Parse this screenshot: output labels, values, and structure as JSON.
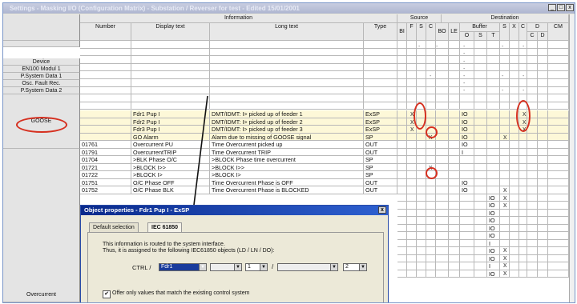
{
  "window": {
    "title": "Settings - Masking I/O (Configuration Matrix) - Substation / Reverser for test - Edited 15/01/2001",
    "min_label": "_",
    "max_label": "□",
    "close_label": "x"
  },
  "groups": {
    "information": "Information",
    "source": "Source",
    "destination": "Destination"
  },
  "columns": {
    "number": "Number",
    "display": "Display text",
    "long": "Long text",
    "type": "Type",
    "bi": "BI",
    "f": "F",
    "s": "S",
    "c": "C",
    "bo": "BO",
    "le": "LE",
    "buffer": "Buffer",
    "o": "O",
    "s2": "S",
    "t": "T",
    "s3": "S",
    "x": "X",
    "c2": "C",
    "d": "D",
    "dc": "C",
    "dd": "D",
    "cm": "CM"
  },
  "sections": {
    "device": "Device",
    "en100": "EN100 Modul 1",
    "psys1": "P.System Data 1",
    "oscfault": "Osc. Fault Rec.",
    "psys2": "P.System Data 2",
    "goose": "GOOSE",
    "overcurrent": "Overcurrent"
  },
  "rows": [
    {
      "number": "",
      "display": "Fdr1 Pup I",
      "long": "DMT/IDMT: I> picked up of feeder 1",
      "type": "ExSP",
      "buf": "IO"
    },
    {
      "number": "",
      "display": "Fdr2 Pup I",
      "long": "DMT/IDMT: I> picked up of feeder 2",
      "type": "ExSP",
      "buf": "IO"
    },
    {
      "number": "",
      "display": "Fdr3 Pup I",
      "long": "DMT/IDMT: I> picked up of feeder 3",
      "type": "ExSP",
      "buf": "IO"
    },
    {
      "number": "",
      "display": "GO Alarm",
      "long": "Alarm due to missing of GOOSE signal",
      "type": "SP",
      "buf": "IO"
    },
    {
      "number": "01761",
      "display": "Overcurrent PU",
      "long": "Time Overcurrent picked up",
      "type": "OUT",
      "buf": "IO"
    },
    {
      "number": "01791",
      "display": "OvercurrentTRIP",
      "long": "Time Overcurrent TRIP",
      "type": "OUT",
      "buf": "I"
    },
    {
      "number": "01704",
      "display": ">BLK Phase O/C",
      "long": ">BLOCK Phase time overcurrent",
      "type": "SP",
      "buf": ""
    },
    {
      "number": "01721",
      "display": ">BLOCK I>>",
      "long": ">BLOCK I>>",
      "type": "SP",
      "buf": ""
    },
    {
      "number": "01722",
      "display": ">BLOCK I>",
      "long": ">BLOCK I>",
      "type": "SP",
      "buf": ""
    },
    {
      "number": "01751",
      "display": "O/C Phase OFF",
      "long": "Time Overcurrent Phase is OFF",
      "type": "OUT",
      "buf": "IO"
    },
    {
      "number": "01752",
      "display": "O/C Phase BLK",
      "long": "Time Overcurrent Phase is BLOCKED",
      "type": "OUT",
      "buf": "IO"
    }
  ],
  "extra_io": [
    "IO",
    "IO",
    "IO",
    "IO",
    "IO",
    "IO",
    "I",
    "IO",
    "IO",
    "I",
    "IO"
  ],
  "dialog": {
    "title": "Object properties - Fdr1 Pup I - ExSP",
    "close": "x",
    "tabs": [
      "Default selection",
      "IEC 61850"
    ],
    "text1": "This information is routed to the system interface.",
    "text2": "Thus, it is assigned to the following IEC61850 objects (LD / LN / DO):",
    "ctrl_label": "CTRL",
    "slash": "/",
    "ln_value": "Fdr1",
    "ln_num": "1",
    "do_num": "2",
    "checkbox_label": "Offer only values that match the existing control system",
    "checkbox_mark": "✔"
  },
  "mark_glyph": "x",
  "dash_glyph": "-",
  "colors": {
    "highlight": "#fdf8d8",
    "annot": "#d63020",
    "dialog_title": "#0a2a8c"
  }
}
